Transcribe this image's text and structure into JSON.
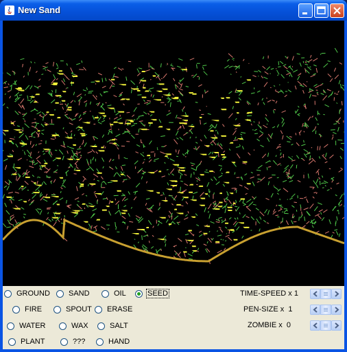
{
  "window": {
    "title": "New Sand"
  },
  "tools": [
    {
      "id": "ground",
      "label": "GROUND",
      "selected": false
    },
    {
      "id": "sand",
      "label": "SAND",
      "selected": false
    },
    {
      "id": "oil",
      "label": "OIL",
      "selected": false
    },
    {
      "id": "seed",
      "label": "SEED",
      "selected": true
    },
    {
      "id": "fire",
      "label": "FIRE",
      "selected": false
    },
    {
      "id": "spout",
      "label": "SPOUT",
      "selected": false
    },
    {
      "id": "erase",
      "label": "ERASE",
      "selected": false
    },
    {
      "id": "water",
      "label": "WATER",
      "selected": false
    },
    {
      "id": "wax",
      "label": "WAX",
      "selected": false
    },
    {
      "id": "salt",
      "label": "SALT",
      "selected": false
    },
    {
      "id": "plant",
      "label": "PLANT",
      "selected": false
    },
    {
      "id": "unknown",
      "label": "???",
      "selected": false
    },
    {
      "id": "hand",
      "label": "HAND",
      "selected": false
    }
  ],
  "settings": {
    "time_speed": {
      "label": "TIME-SPEED x",
      "value": "1"
    },
    "pen_size": {
      "label": "PEN-SIZE x",
      "value": "1"
    },
    "zombie": {
      "label": "ZOMBIE x",
      "value": "0"
    }
  },
  "colors": {
    "background": "#000000",
    "plant": "#4fc94a",
    "root": "#d9786e",
    "seed": "#f0f03a",
    "ground": "#c8a030",
    "titlebar": "#0550d8",
    "panel": "#ece9d8"
  }
}
